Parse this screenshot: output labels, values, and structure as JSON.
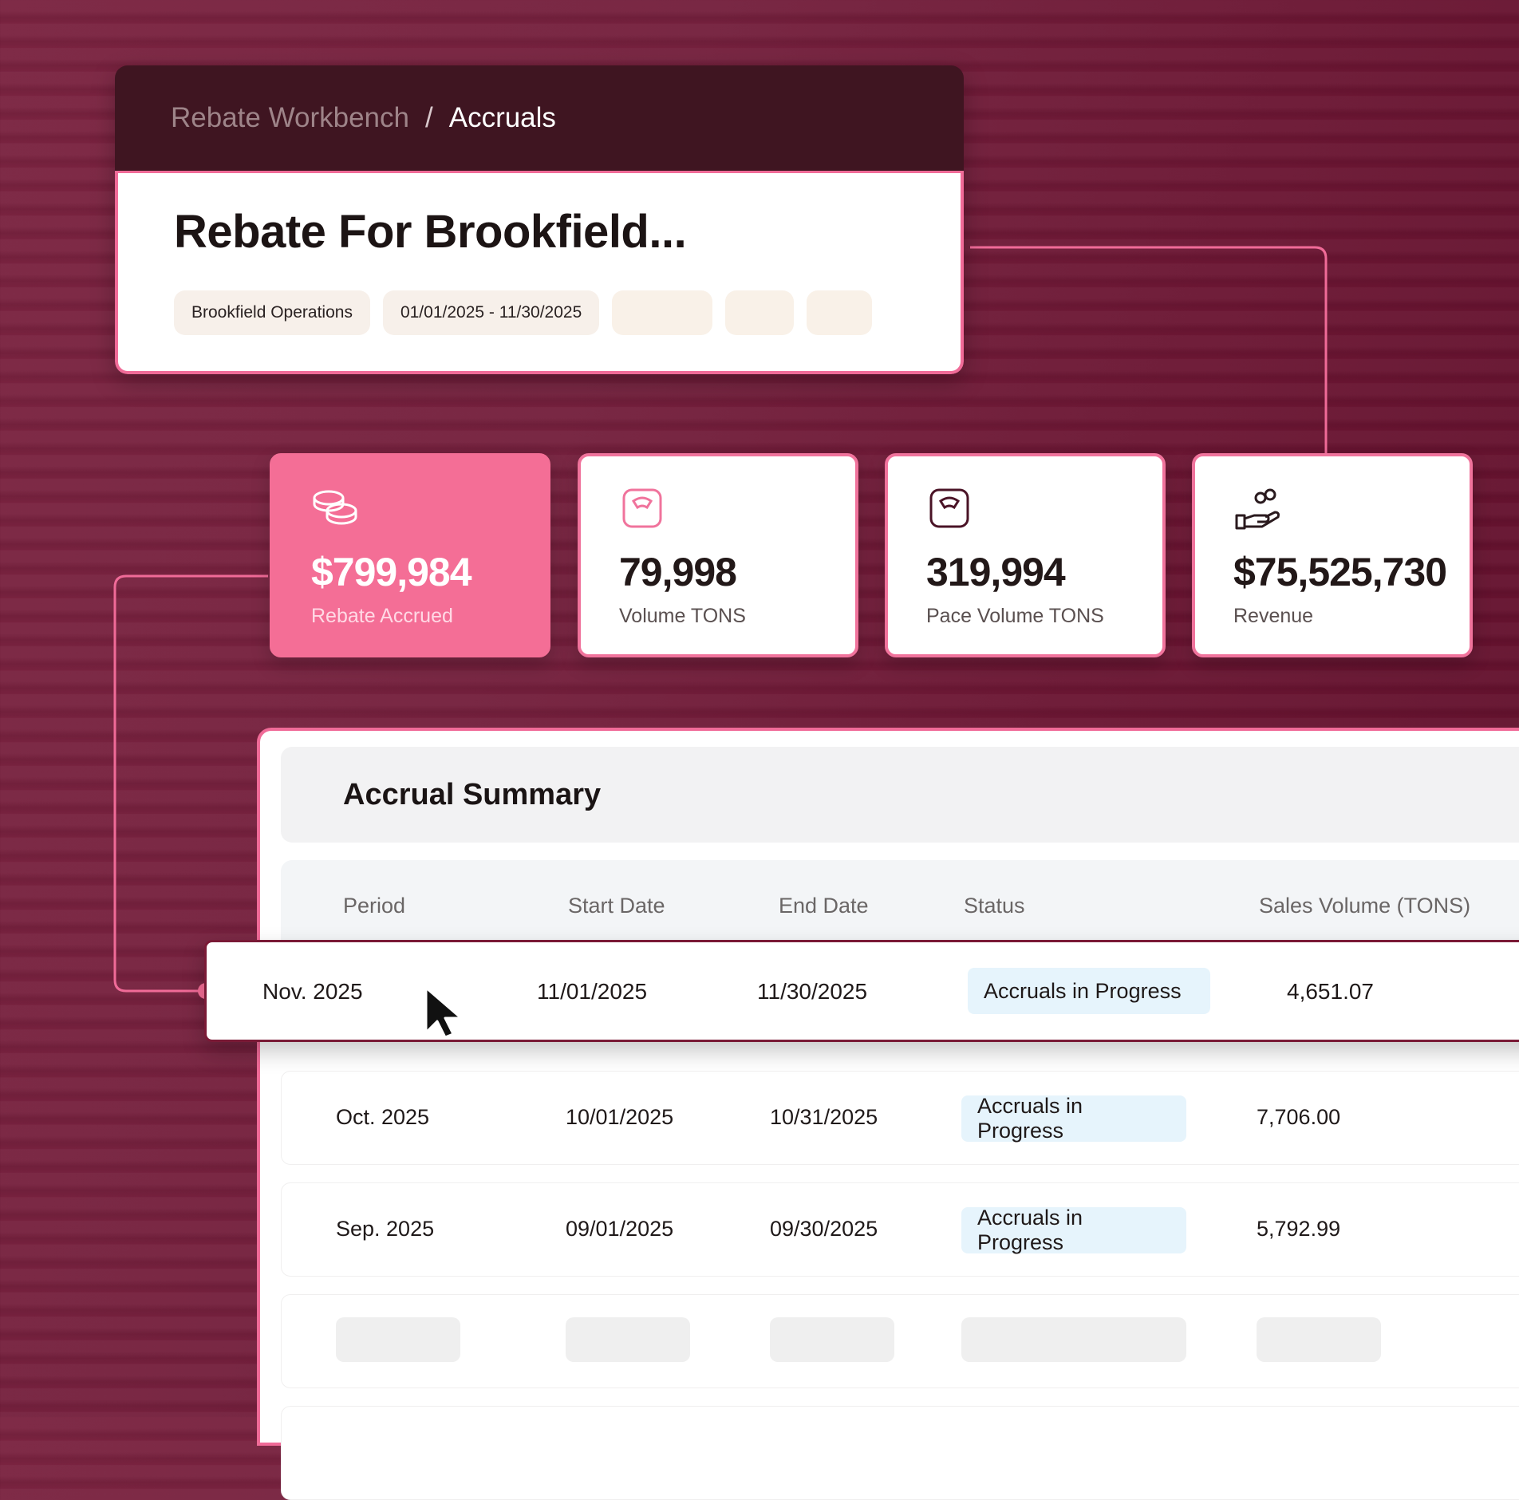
{
  "breadcrumb": {
    "parent": "Rebate Workbench",
    "separator": "/",
    "current": "Accruals"
  },
  "header": {
    "title": "Rebate For Brookfield...",
    "chips": [
      "Brookfield Operations",
      "01/01/2025 - 11/30/2025"
    ]
  },
  "stats": [
    {
      "icon": "coins-icon",
      "value": "$799,984",
      "label": "Rebate Accrued"
    },
    {
      "icon": "scale-icon",
      "value": "79,998",
      "label": "Volume TONS"
    },
    {
      "icon": "scale-icon",
      "value": "319,994",
      "label": "Pace Volume TONS"
    },
    {
      "icon": "hand-coins-icon",
      "value": "$75,525,730",
      "label": "Revenue"
    }
  ],
  "summary": {
    "title": "Accrual Summary",
    "columns": [
      "Period",
      "Start Date",
      "End Date",
      "Status",
      "Sales Volume (TONS)"
    ],
    "rows": [
      {
        "period": "Nov. 2025",
        "start": "11/01/2025",
        "end": "11/30/2025",
        "status": "Accruals in Progress",
        "volume": "4,651.07"
      },
      {
        "period": "Oct. 2025",
        "start": "10/01/2025",
        "end": "10/31/2025",
        "status": "Accruals in Progress",
        "volume": "7,706.00"
      },
      {
        "period": "Sep. 2025",
        "start": "09/01/2025",
        "end": "09/30/2025",
        "status": "Accruals in Progress",
        "volume": "5,792.99"
      }
    ]
  },
  "colors": {
    "accent": "#f46e96",
    "dark": "#3f1521",
    "badge": "#e6f4fc"
  }
}
